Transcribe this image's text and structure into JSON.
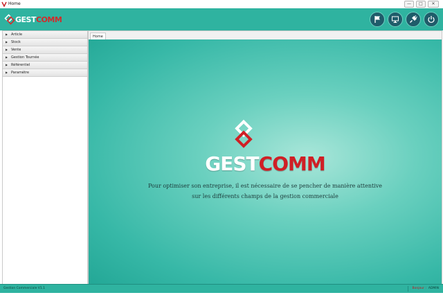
{
  "window": {
    "title": "Home",
    "controls": {
      "minimize": "—",
      "maximize": "□",
      "close": "✕"
    }
  },
  "header": {
    "logo": {
      "part1": "GEST",
      "part2": "COMM"
    },
    "buttons": [
      {
        "icon": "flag-icon"
      },
      {
        "icon": "monitor-icon"
      },
      {
        "icon": "plug-icon"
      },
      {
        "icon": "power-icon"
      }
    ]
  },
  "sidebar": {
    "items": [
      {
        "label": "Article"
      },
      {
        "label": "Stock"
      },
      {
        "label": "Vente"
      },
      {
        "label": "Gestion Tournée"
      },
      {
        "label": "Référentiel"
      },
      {
        "label": "Paramétre"
      }
    ]
  },
  "tabs": [
    {
      "label": "Home"
    }
  ],
  "content": {
    "brand": {
      "part1": "GEST",
      "part2": "COMM"
    },
    "tagline_line1": "Pour optimiser son entreprise, il est nécessaire de se pencher de manière attentive",
    "tagline_line2": "sur les différents champs de la gestion commerciale"
  },
  "statusbar": {
    "app_name": "Gestion Commerciale V1.1",
    "user_label": "Bonjour :",
    "user_name": "ADMIN"
  },
  "colors": {
    "teal": "#2fb3a0",
    "brand_red": "#d01f25",
    "button_dark": "#1f5c6a"
  }
}
